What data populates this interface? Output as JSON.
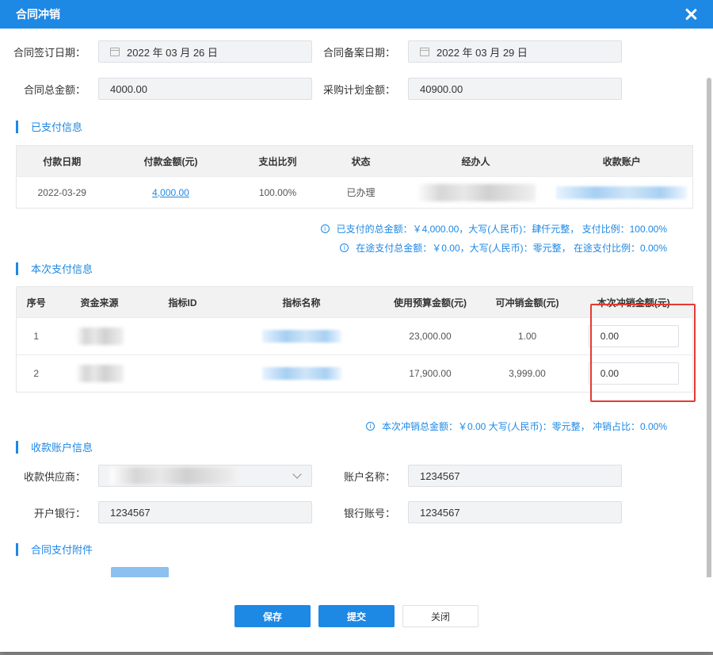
{
  "dialog": {
    "title": "合同冲销"
  },
  "contract": {
    "sign_date_label": "合同签订日期：",
    "sign_date": "2022 年 03 月 26 日",
    "filing_date_label": "合同备案日期：",
    "filing_date": "2022 年 03 月 29 日",
    "total_amount_label": "合同总金额：",
    "total_amount": "4000.00",
    "plan_amount_label": "采购计划金额：",
    "plan_amount": "40900.00"
  },
  "paid_section": {
    "title": "已支付信息",
    "headers": [
      "付款日期",
      "付款金额(元)",
      "支出比列",
      "状态",
      "经办人",
      "收款账户"
    ],
    "rows": [
      {
        "date": "2022-03-29",
        "amount": "4,000.00",
        "ratio": "100.00%",
        "status": "已办理"
      }
    ],
    "summary1": "已支付的总金额：￥4,000.00，大写(人民币)：肆仟元整，  支付比例：100.00%",
    "summary2": "在途支付总金额：￥0.00，大写(人民币)：零元整，  在途支付比例：0.00%"
  },
  "current_section": {
    "title": "本次支付信息",
    "headers": [
      "序号",
      "资金来源",
      "指标ID",
      "指标名称",
      "使用预算金额(元)",
      "可冲销金额(元)",
      "本次冲销金额(元)"
    ],
    "rows": [
      {
        "index": "1",
        "budget": "23,000.00",
        "offset_available": "1.00",
        "offset_value": "0.00"
      },
      {
        "index": "2",
        "budget": "17,900.00",
        "offset_available": "3,999.00",
        "offset_value": "0.00"
      }
    ],
    "summary": "本次冲销总金额：￥0.00 大写(人民币)：零元整，  冲销占比：0.00%"
  },
  "payee_section": {
    "title": "收款账户信息",
    "supplier_label": "收款供应商：",
    "account_name_label": "账户名称：",
    "account_name": "1234567",
    "bank_label": "开户银行：",
    "bank": "1234567",
    "account_no_label": "银行账号：",
    "account_no": "1234567"
  },
  "attachment_section": {
    "title": "合同支付附件"
  },
  "footer": {
    "save": "保存",
    "submit": "提交",
    "close": "关闭"
  },
  "colors": {
    "primary": "#1e88e5",
    "highlight_box": "#e53935"
  }
}
